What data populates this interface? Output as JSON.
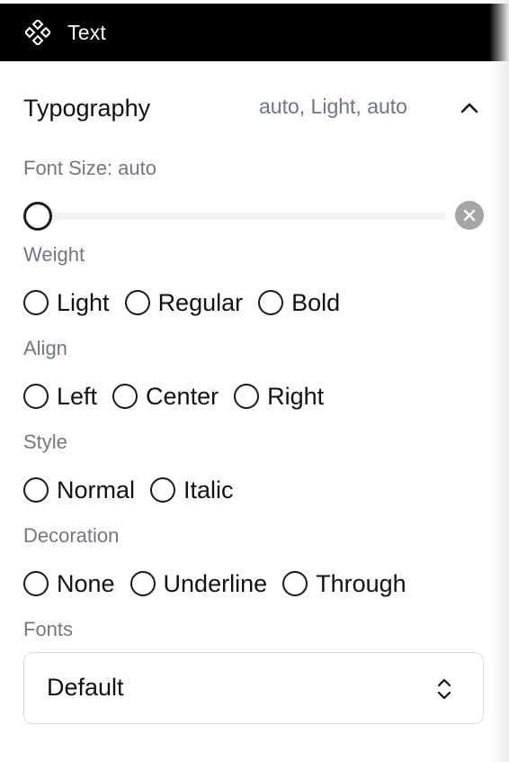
{
  "header": {
    "icon": "component-diamond-icon",
    "title": "Text"
  },
  "typography": {
    "title": "Typography",
    "summary": "auto, Light, auto",
    "collapse_icon": "chevron-up-icon",
    "font_size": {
      "label": "Font Size: auto",
      "slider_value": 0,
      "clear_icon": "clear-x-icon"
    },
    "weight": {
      "label": "Weight",
      "options": [
        "Light",
        "Regular",
        "Bold"
      ]
    },
    "align": {
      "label": "Align",
      "options": [
        "Left",
        "Center",
        "Right"
      ]
    },
    "style": {
      "label": "Style",
      "options": [
        "Normal",
        "Italic"
      ]
    },
    "decoration": {
      "label": "Decoration",
      "options": [
        "None",
        "Underline",
        "Through"
      ]
    },
    "fonts": {
      "label": "Fonts",
      "value": "Default",
      "select_icon": "updown-chevron-icon"
    }
  },
  "colors": {
    "header_bg": "#000000",
    "header_text": "#ffffff",
    "muted_text": "#727880",
    "clear_button": "#a5a5a5"
  }
}
